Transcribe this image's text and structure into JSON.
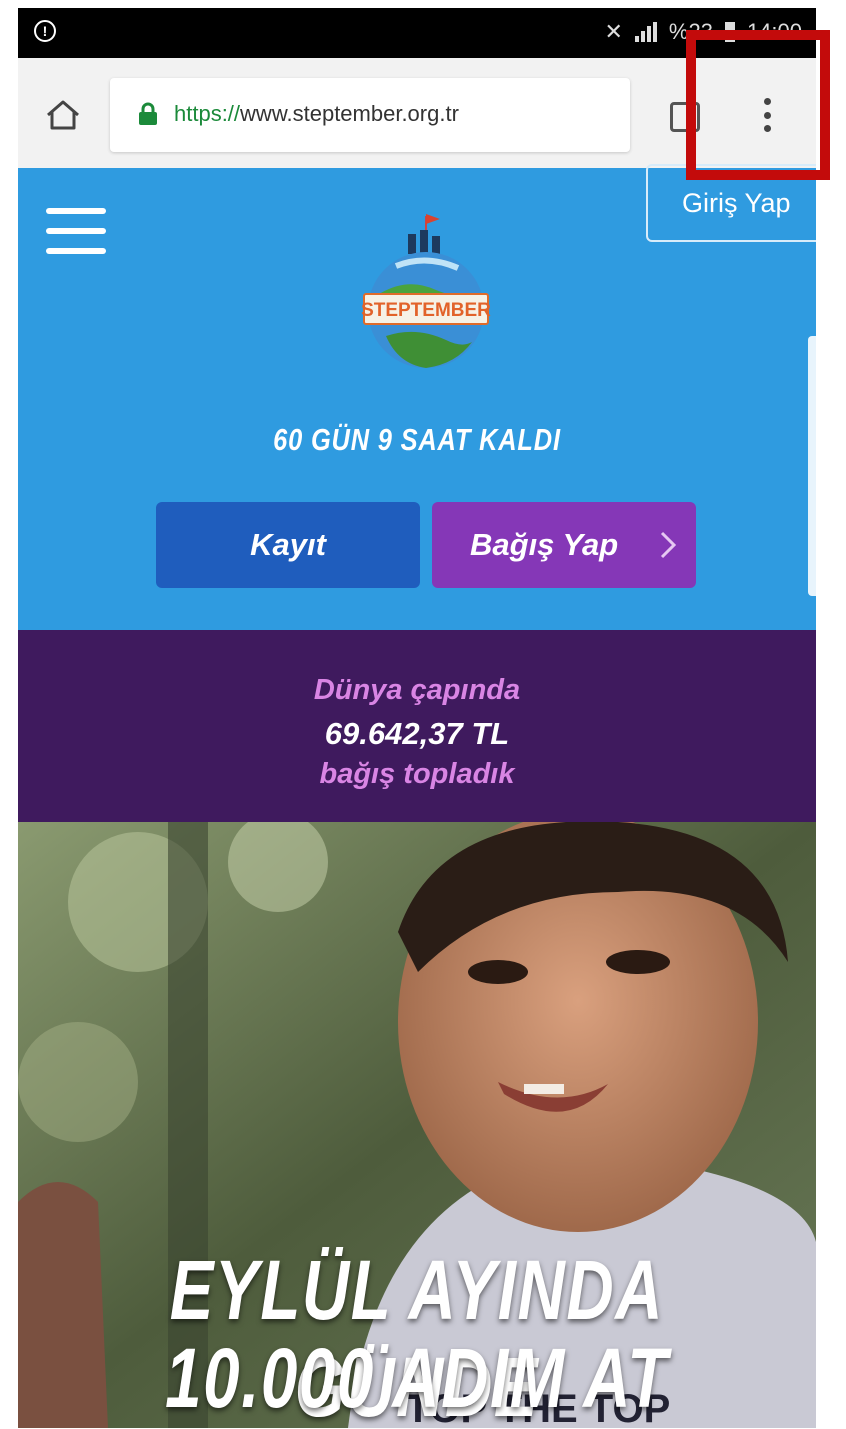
{
  "status_bar": {
    "left_icon": "alert-circle-icon",
    "battery_text": "%23",
    "time": "14:00"
  },
  "browser": {
    "url_scheme": "https://",
    "url_host": "www.steptember.org.tr",
    "icons": [
      "home-icon",
      "lock-icon",
      "tabs-icon",
      "more-vert-icon"
    ]
  },
  "header": {
    "login_label": "Giriş Yap",
    "logo_text": "STEPTEMBER",
    "countdown": "60 GÜN 9 SAAT KALDI",
    "register_label": "Kayıt",
    "donate_label": "Bağış Yap"
  },
  "donations": {
    "line1": "Dünya çapında",
    "amount": "69.642,37 TL",
    "line3": "bağış topladık"
  },
  "hero": {
    "headline_line1": "EYLÜL AYINDA GÜNDE",
    "headline_line2": "10.000 ADIM AT",
    "shirt_text": "TOP THE TOP"
  },
  "colors": {
    "hero_blue": "#2f9be0",
    "register_blue": "#1f5dbd",
    "donate_purple": "#8537b7",
    "band_purple": "#3f1a5e",
    "band_text_pink": "#d985e4",
    "highlight_red": "#c30b0b"
  }
}
